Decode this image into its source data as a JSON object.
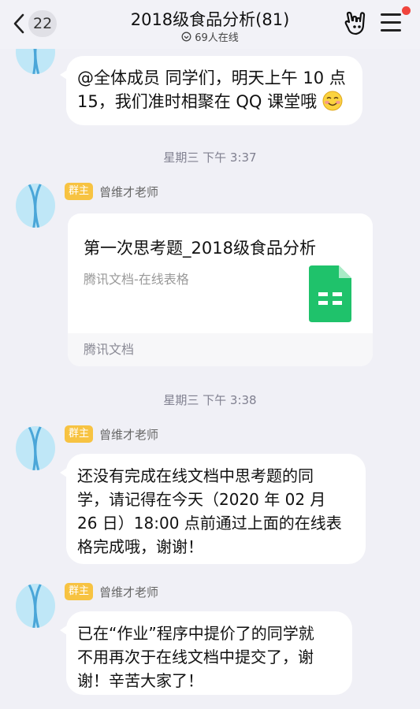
{
  "header": {
    "unread_count": "22",
    "title": "2018级食品分析(81)",
    "online": "69人在线",
    "colors": {
      "bg": "#f2f2f7",
      "notify_dot": "#f0443c"
    },
    "icons": [
      "back-chevron-icon",
      "online-status-icon",
      "rock-hand-icon",
      "menu-icon"
    ]
  },
  "messages": [
    {
      "text": "@全体成员 同学们，明天上午 10 点 15，我们准时相聚在 QQ 课堂哦",
      "line1": "@全体成员 同学们，明天上午 10 点",
      "line2": "15，我们准时相聚在 QQ 课堂哦",
      "emoji": "smile-emoji"
    },
    {
      "timestamp": "星期三 下午 3:37",
      "sender_tag": "群主",
      "sender_name": "曾维才老师",
      "card": {
        "title": "第一次思考题_2018级食品分析",
        "subtitle": "腾讯文档-在线表格",
        "footer": "腾讯文档",
        "icon": "spreadsheet-icon",
        "icon_color": "#1fc26b"
      }
    },
    {
      "timestamp": "星期三 下午 3:38",
      "sender_tag": "群主",
      "sender_name": "曾维才老师",
      "lines": [
        "还没有完成在线文档中思考题的同",
        "学，请记得在今天（2020 年 02 月",
        "26 日）18:00 点前通过上面的在线表",
        "格完成哦，谢谢！"
      ]
    },
    {
      "sender_tag": "群主",
      "sender_name": "曾维才老师",
      "lines": [
        "已在“作业”程序中提价了的同学就",
        "不用再次于在线文档中提交了，谢",
        "谢！辛苦大家了！"
      ]
    }
  ],
  "theme": {
    "owner_tag_color": "#f7c342",
    "bubble_color": "#ffffff",
    "bg": "#f0f0f6"
  }
}
